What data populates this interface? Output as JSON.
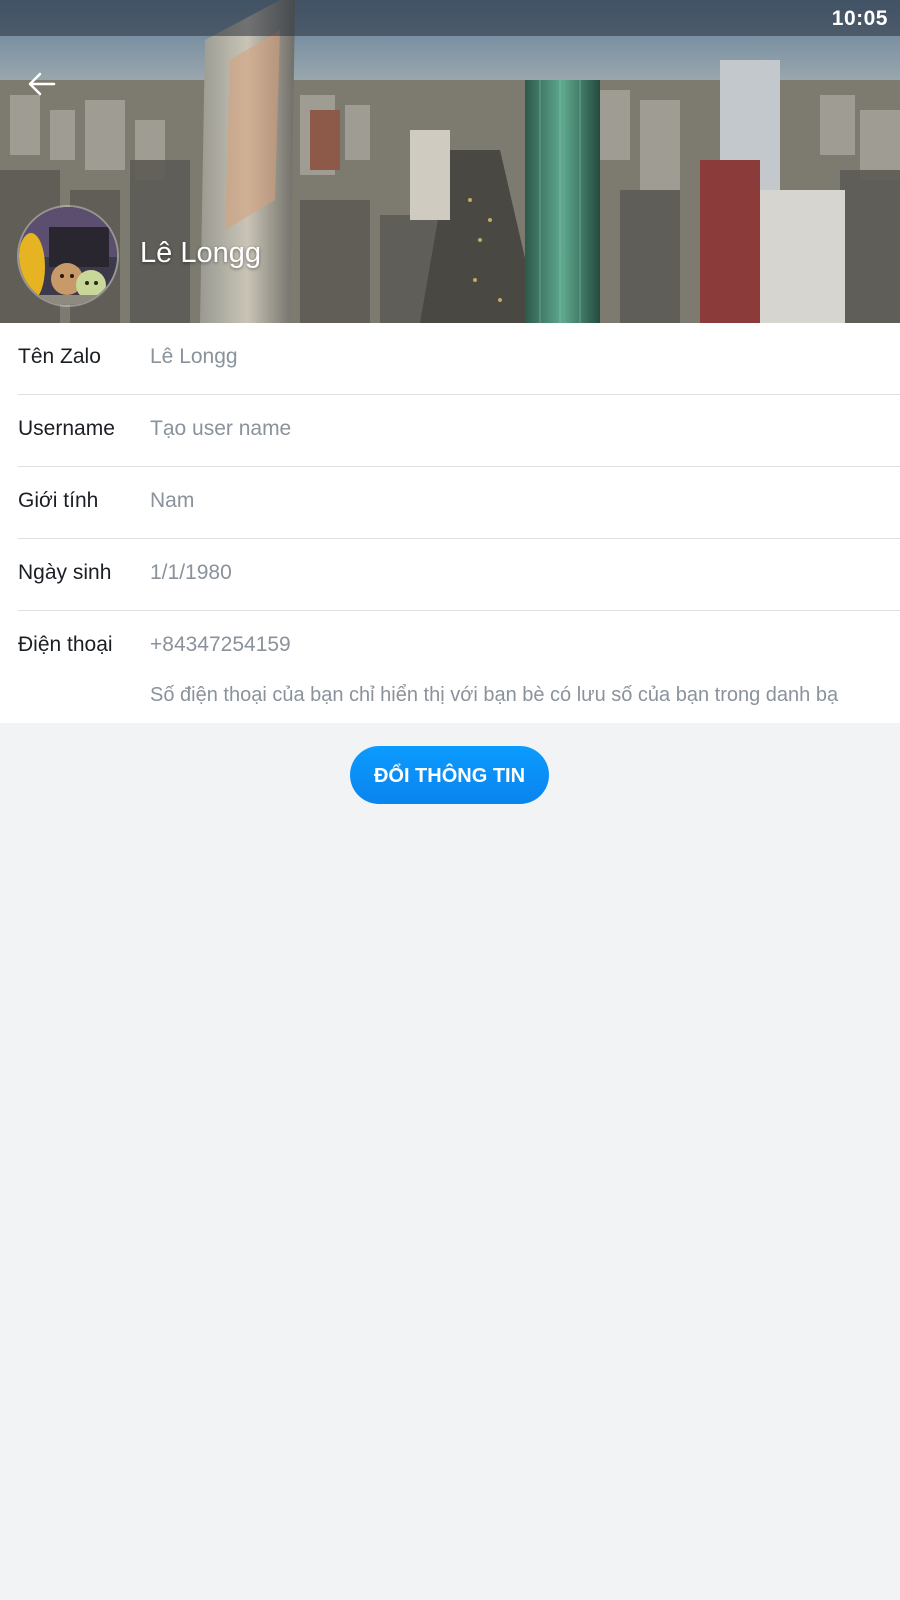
{
  "status_bar": {
    "time": "10:05"
  },
  "header": {
    "back_icon": "arrow-left-icon",
    "profile_name": "Lê Longg"
  },
  "profile": {
    "fields": [
      {
        "label": "Tên Zalo",
        "value": "Lê Longg"
      },
      {
        "label": "Username",
        "value": "Tạo user name"
      },
      {
        "label": "Giới tính",
        "value": "Nam"
      },
      {
        "label": "Ngày sinh",
        "value": "1/1/1980"
      },
      {
        "label": "Điện thoại",
        "value": "+84347254159",
        "note": "Số điện thoại của bạn chỉ hiển thị với bạn bè có lưu số của bạn trong danh bạ"
      }
    ]
  },
  "actions": {
    "edit_label": "ĐỔI THÔNG TIN"
  },
  "colors": {
    "accent": "#0a8ff5",
    "label_text": "#1b1f24",
    "value_text": "#8a929b",
    "page_background": "#f1f3f5"
  }
}
